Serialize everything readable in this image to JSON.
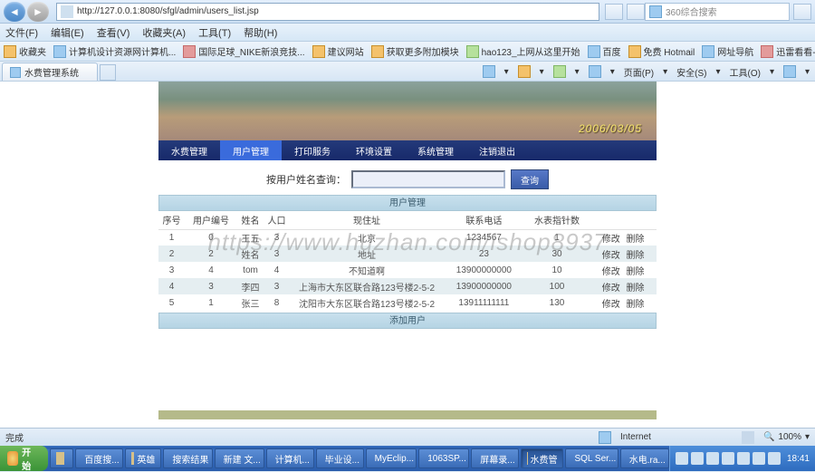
{
  "titlebar": {
    "url": "http://127.0.0.1:8080/sfgl/admin/users_list.jsp",
    "search_placeholder": "360综合搜索"
  },
  "menubar": [
    "文件(F)",
    "编辑(E)",
    "查看(V)",
    "收藏夹(A)",
    "工具(T)",
    "帮助(H)"
  ],
  "bookbar": {
    "label": "收藏夹",
    "items": [
      "计算机设计资源网计算机...",
      "国际足球_NIKE新浪竞技...",
      "建议网站",
      "获取更多附加模块",
      "hao123_上网从这里开始",
      "百度",
      "免费 Hotmail",
      "网址导航",
      "迅雷看看-中国第一高清..."
    ]
  },
  "toolbar2": {
    "home": "",
    "items": [
      "页面(P)",
      "安全(S)",
      "工具(O)"
    ]
  },
  "tab": {
    "title": "水费管理系统"
  },
  "banner_date": "2006/03/05",
  "mainnav": [
    "水费管理",
    "用户管理",
    "打印服务",
    "环境设置",
    "系统管理",
    "注销退出"
  ],
  "search": {
    "label": "按用户姓名查询：",
    "button": "查询"
  },
  "table": {
    "title": "用户管理",
    "headers": [
      "序号",
      "用户编号",
      "姓名",
      "人口",
      "现住址",
      "联系电话",
      "水表指针数",
      ""
    ],
    "rows": [
      [
        "1",
        "0",
        "王五",
        "3",
        "北京",
        "1234567",
        "1",
        "修改 删除"
      ],
      [
        "2",
        "2",
        "姓名",
        "3",
        "地址",
        "23",
        "30",
        "修改 删除"
      ],
      [
        "3",
        "4",
        "tom",
        "4",
        "不知道啊",
        "13900000000",
        "10",
        "修改 删除"
      ],
      [
        "4",
        "3",
        "李四",
        "3",
        "上海市大东区联合路123号楼2-5-2",
        "13900000000",
        "100",
        "修改 删除"
      ],
      [
        "5",
        "1",
        "张三",
        "8",
        "沈阳市大东区联合路123号楼2-5-2",
        "13911111111",
        "130",
        "修改 删除"
      ]
    ],
    "add": "添加用户",
    "edit": "修改",
    "del": "删除"
  },
  "watermark": "https://www.huzhan.com/ishop8937",
  "status": {
    "done": "完成",
    "zone": "Internet",
    "zoom": "100%"
  },
  "taskbar": {
    "start": "开始",
    "items": [
      "",
      "百度搜...",
      "英雄",
      "搜索结果",
      "新建 文...",
      "计算机...",
      "毕业设...",
      "MyEclip...",
      "1063SP...",
      "屏幕录...",
      "水费管",
      "SQL Ser...",
      "水电.ra..."
    ],
    "time": "18:41"
  }
}
